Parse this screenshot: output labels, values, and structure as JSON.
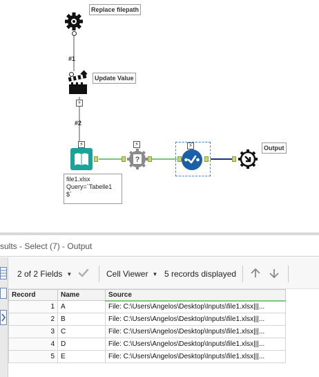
{
  "canvas": {
    "tools": {
      "replace_filepath": {
        "label": "Replace filepath",
        "icon": "gear-tool-icon"
      },
      "update_value": {
        "label": "Update Value",
        "icon": "clapperboard-icon"
      },
      "input": {
        "icon": "book-input-icon",
        "annotation": [
          "file1.xlsx",
          "Query=`Tabelle1",
          "$`"
        ]
      },
      "test_tool": {
        "icon": "question-gear-icon"
      },
      "select_tool": {
        "icon": "select-check-icon"
      },
      "output": {
        "label": "Output",
        "icon": "output-gear-icon"
      }
    },
    "connections": {
      "c1": "#1",
      "c2": "#2"
    }
  },
  "results": {
    "title": "sults - Select (7) - Output",
    "toolbar": {
      "fields": "2 of 2 Fields",
      "viewer": "Cell Viewer",
      "records": "5 records displayed"
    },
    "columns": [
      "Record",
      "Name",
      "Source"
    ],
    "rows": [
      {
        "record": "1",
        "name": "A",
        "source": "File: C:\\Users\\Angelos\\Desktop\\Inputs\\file1.xlsx|||..."
      },
      {
        "record": "2",
        "name": "B",
        "source": "File: C:\\Users\\Angelos\\Desktop\\Inputs\\file1.xlsx|||..."
      },
      {
        "record": "3",
        "name": "C",
        "source": "File: C:\\Users\\Angelos\\Desktop\\Inputs\\file1.xlsx|||..."
      },
      {
        "record": "4",
        "name": "D",
        "source": "File: C:\\Users\\Angelos\\Desktop\\Inputs\\file1.xlsx|||..."
      },
      {
        "record": "5",
        "name": "E",
        "source": "File: C:\\Users\\Angelos\\Desktop\\Inputs\\file1.xlsx|||..."
      }
    ]
  },
  "colors": {
    "anchor": "#c7d670",
    "select_blue": "#1b5fa8",
    "input_teal": "#1aa39a",
    "connection_green": "#4caf50",
    "connection_blue": "#1f2a8a"
  }
}
